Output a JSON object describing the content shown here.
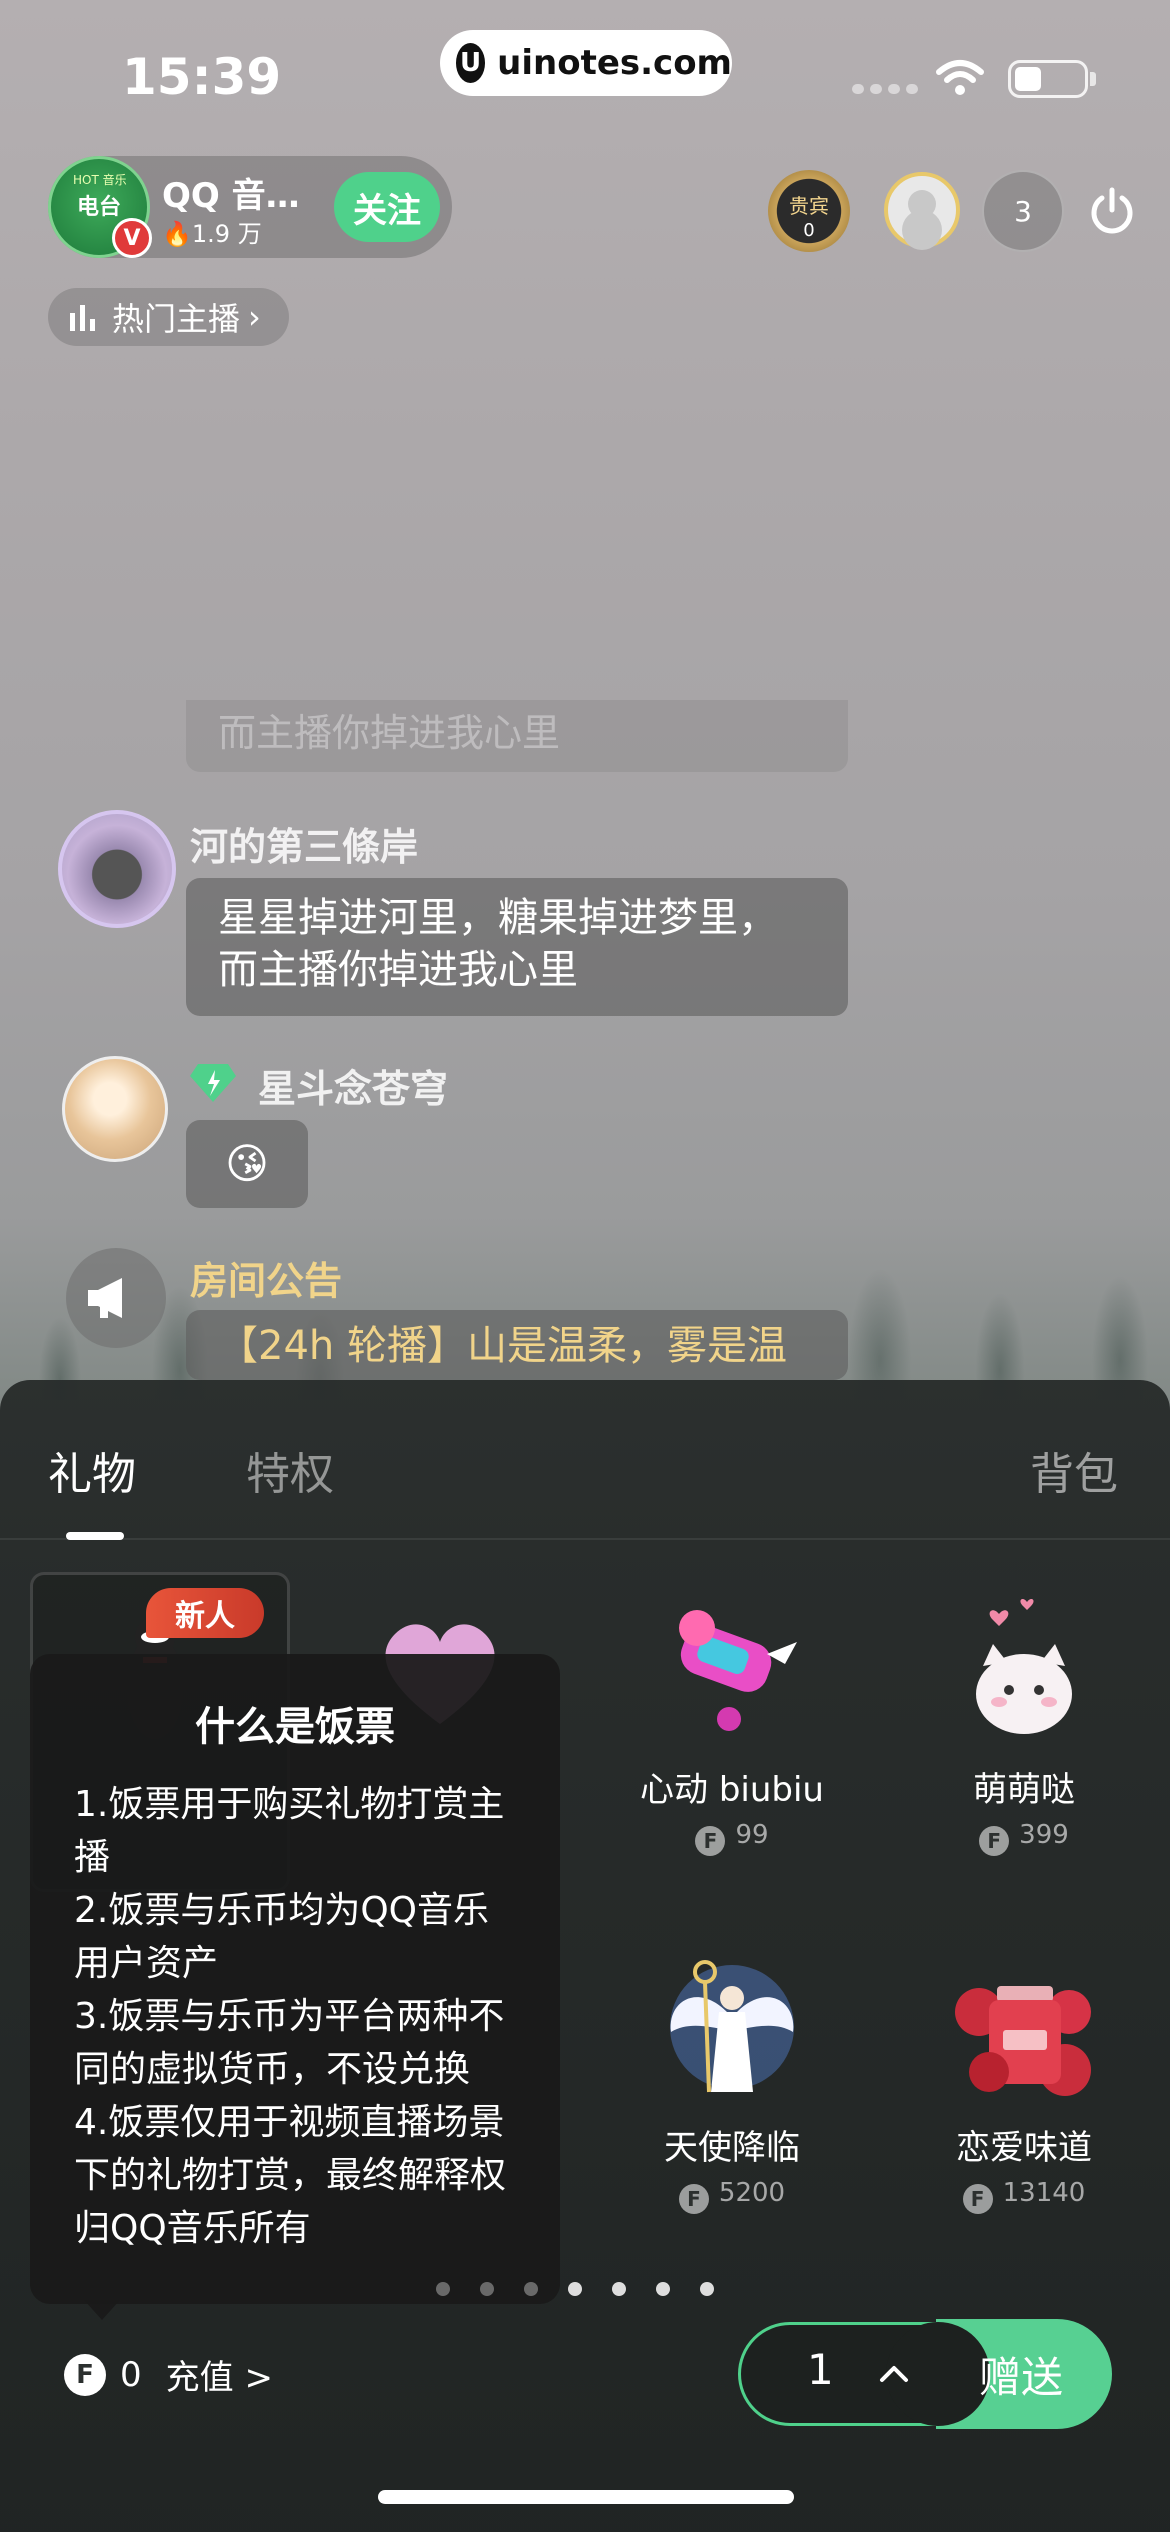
{
  "status_bar": {
    "time": "15:39",
    "url": "uinotes.com"
  },
  "anchor": {
    "name": "QQ 音…",
    "heat": "1.9 万",
    "follow_label": "关注",
    "avatar_text": "电台",
    "avatar_subtext": "HOT 音乐",
    "verified": "V"
  },
  "header": {
    "vip_label": "贵宾",
    "vip_count": "0",
    "viewer_count": "3"
  },
  "hot_anchor_label": "热门主播",
  "chat": {
    "ghost_text": "而主播你掉进我心里",
    "messages": [
      {
        "name": "河的第三條岸",
        "text_line1": "星星掉进河里，糖果掉进梦里，",
        "text_line2": "而主播你掉进我心里"
      },
      {
        "name": "星斗念苍穹",
        "text": "😘"
      }
    ],
    "notice": {
      "title": "房间公告",
      "text": "【24h 轮播】山是温柔，雾是温"
    }
  },
  "gift_panel": {
    "tabs": {
      "gift": "礼物",
      "privilege": "特权",
      "bag": "背包"
    },
    "new_badge": "新人",
    "gifts": [
      {
        "name": "心动 biubiu",
        "price": "99"
      },
      {
        "name": "萌萌哒",
        "price": "399"
      },
      {
        "name": "天使降临",
        "price": "5200"
      },
      {
        "name": "恋爱味道",
        "price": "13140"
      }
    ],
    "tooltip": {
      "title": "什么是饭票",
      "items": [
        "1.饭票用于购买礼物打赏主播",
        "2.饭票与乐币均为QQ音乐用户资产",
        "3.饭票与乐币为平台两种不同的虚拟货币，不设兑换",
        "4.饭票仅用于视频直播场景下的礼物打赏，最终解释权归QQ音乐所有"
      ]
    },
    "balance": {
      "value": "0",
      "recharge_label": "充值 >"
    },
    "quantity": "1",
    "send_label": "赠送"
  },
  "colors": {
    "accent_green": "#57d092",
    "notice_gold": "#f1d48a"
  },
  "icons": [
    "u-logo-icon",
    "wifi-icon",
    "battery-icon",
    "flame-icon",
    "power-icon",
    "bar-chart-icon",
    "chevron-right-icon",
    "megaphone-icon",
    "gem-icon",
    "coin-icon",
    "chevron-up-icon"
  ]
}
